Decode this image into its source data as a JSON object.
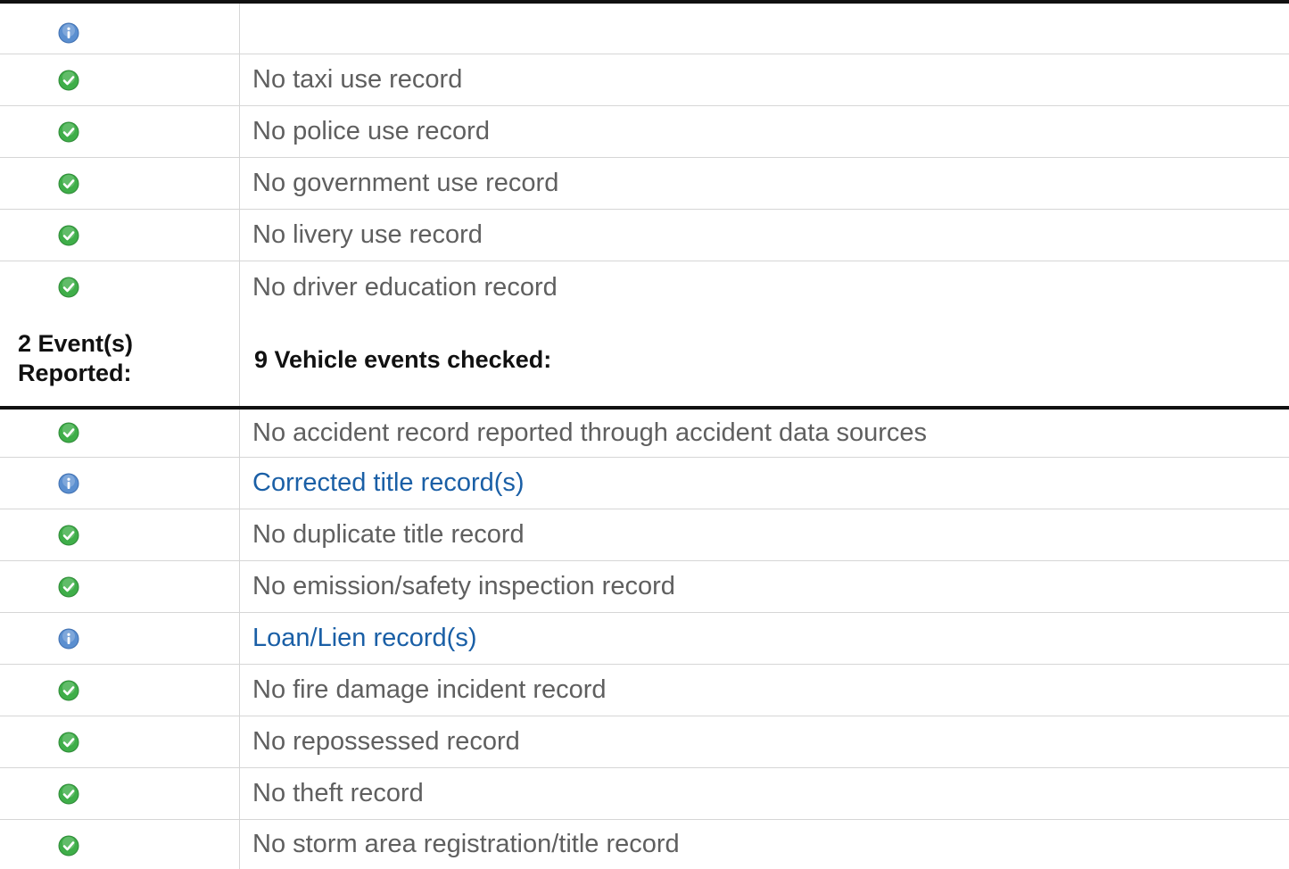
{
  "top_rows": [
    {
      "icon": "info-icon",
      "label": "",
      "link": false
    },
    {
      "icon": "check-icon",
      "label": "No taxi use record",
      "link": false
    },
    {
      "icon": "check-icon",
      "label": "No police use record",
      "link": false
    },
    {
      "icon": "check-icon",
      "label": "No government use record",
      "link": false
    },
    {
      "icon": "check-icon",
      "label": "No livery use record",
      "link": false
    },
    {
      "icon": "check-icon",
      "label": "No driver education record",
      "link": false
    }
  ],
  "events_section": {
    "reported_line1": "2 Event(s)",
    "reported_line2": "Reported:",
    "checked_label": "9 Vehicle events checked:"
  },
  "event_rows": [
    {
      "icon": "check-icon",
      "label": "No accident record reported through accident data sources",
      "link": false
    },
    {
      "icon": "info-icon",
      "label": "Corrected title record(s)",
      "link": true
    },
    {
      "icon": "check-icon",
      "label": "No duplicate title record",
      "link": false
    },
    {
      "icon": "check-icon",
      "label": "No emission/safety inspection record",
      "link": false
    },
    {
      "icon": "info-icon",
      "label": "Loan/Lien record(s)",
      "link": true
    },
    {
      "icon": "check-icon",
      "label": "No fire damage incident record",
      "link": false
    },
    {
      "icon": "check-icon",
      "label": "No repossessed record",
      "link": false
    },
    {
      "icon": "check-icon",
      "label": "No theft record",
      "link": false
    },
    {
      "icon": "check-icon",
      "label": "No storm area registration/title record",
      "link": false
    }
  ],
  "colors": {
    "text_gray": "#5f5f5f",
    "link_blue": "#1a5fa6",
    "check_green": "#3fae49",
    "info_blue": "#5b8fd0",
    "divider": "#d6d6d6"
  }
}
